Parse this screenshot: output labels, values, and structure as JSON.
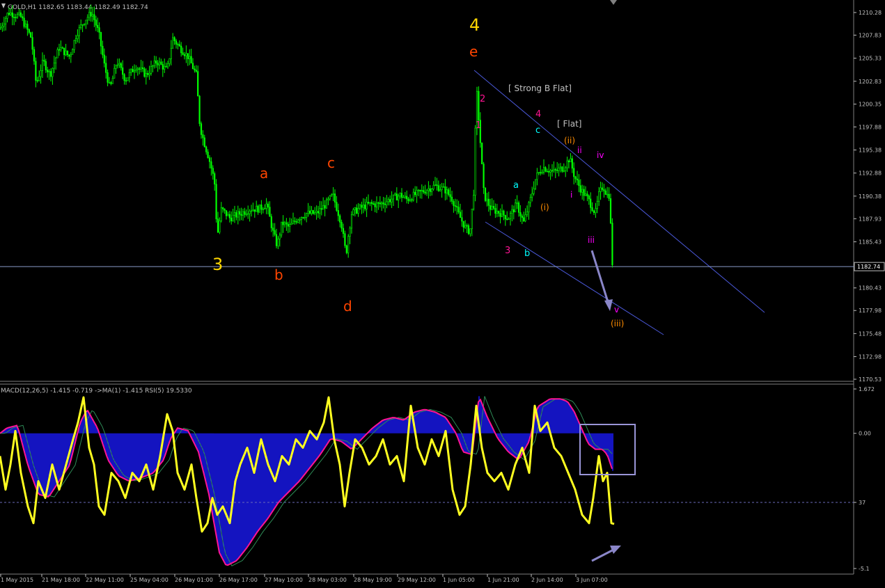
{
  "header": {
    "symbol_info": "GOLD,H1  1182.65 1183.44 1182.49 1182.74",
    "indicator_info": "MACD(12,26,5) -1.415 -0.719  ->MA(1) -1.415  RSI(5) 19.5330"
  },
  "colors": {
    "background": "#000000",
    "candles": "#00ff00",
    "axis": "#c0c0c0",
    "price_line": "#8a9cc8",
    "channel": "#4a58d8",
    "macd_hist": "#1a1af0",
    "signal_line": "#ff1493",
    "rsi_line": "#ffff20",
    "box": "#9a96d8",
    "arrow": "#8a86c8"
  },
  "chart_data": [
    {
      "type": "candlestick",
      "title": "GOLD,H1",
      "symbol": "GOLD",
      "timeframe": "H1",
      "last_bar": {
        "open": 1182.65,
        "high": 1183.44,
        "low": 1182.49,
        "close": 1182.74
      },
      "current_price_label": "1182.74",
      "y_ticks": [
        "1210.28",
        "1207.83",
        "1205.33",
        "1202.83",
        "1200.35",
        "1197.88",
        "1195.38",
        "1192.88",
        "1190.38",
        "1187.93",
        "1185.43",
        "1182.93",
        "1180.43",
        "1177.98",
        "1175.48",
        "1172.98",
        "1170.53"
      ],
      "ylim": [
        1170.53,
        1210.28
      ],
      "x_ticks": [
        "1 May 2015",
        "21 May 18:00",
        "22 May 11:00",
        "25 May 04:00",
        "26 May 01:00",
        "26 May 17:00",
        "27 May 10:00",
        "28 May 03:00",
        "28 May 19:00",
        "29 May 12:00",
        "1 Jun 05:00",
        "1 Jun 21:00",
        "2 Jun 14:00",
        "3 Jun 07:00"
      ],
      "price_path": [
        [
          0,
          1208.5
        ],
        [
          12,
          1210.3
        ],
        [
          30,
          1209.8
        ],
        [
          45,
          1207.5
        ],
        [
          52,
          1202.5
        ],
        [
          62,
          1205.0
        ],
        [
          72,
          1203.5
        ],
        [
          85,
          1206.5
        ],
        [
          100,
          1205.5
        ],
        [
          110,
          1208.0
        ],
        [
          122,
          1209.5
        ],
        [
          132,
          1210.3
        ],
        [
          142,
          1208.0
        ],
        [
          150,
          1204.5
        ],
        [
          158,
          1202.0
        ],
        [
          168,
          1205.0
        ],
        [
          180,
          1203.0
        ],
        [
          195,
          1204.5
        ],
        [
          210,
          1203.5
        ],
        [
          225,
          1205.0
        ],
        [
          240,
          1204.0
        ],
        [
          248,
          1207.5
        ],
        [
          258,
          1206.5
        ],
        [
          270,
          1205.5
        ],
        [
          282,
          1203.5
        ],
        [
          287,
          1198.0
        ],
        [
          292,
          1196.5
        ],
        [
          300,
          1194.5
        ],
        [
          308,
          1192.0
        ],
        [
          312,
          1186.0
        ],
        [
          318,
          1189.0
        ],
        [
          330,
          1188.0
        ],
        [
          345,
          1188.5
        ],
        [
          360,
          1189.0
        ],
        [
          372,
          1189.0
        ],
        [
          383,
          1189.5
        ],
        [
          392,
          1186.5
        ],
        [
          398,
          1185.0
        ],
        [
          405,
          1187.5
        ],
        [
          415,
          1187.0
        ],
        [
          428,
          1188.0
        ],
        [
          440,
          1188.5
        ],
        [
          455,
          1188.5
        ],
        [
          468,
          1189.5
        ],
        [
          478,
          1190.5
        ],
        [
          490,
          1187.5
        ],
        [
          497,
          1184.0
        ],
        [
          500,
          1186.0
        ],
        [
          505,
          1188.5
        ],
        [
          515,
          1189.0
        ],
        [
          530,
          1189.5
        ],
        [
          545,
          1189.5
        ],
        [
          560,
          1190.0
        ],
        [
          575,
          1190.5
        ],
        [
          585,
          1190.0
        ],
        [
          595,
          1190.5
        ],
        [
          610,
          1191.0
        ],
        [
          625,
          1191.5
        ],
        [
          640,
          1191.0
        ],
        [
          650,
          1190.0
        ],
        [
          658,
          1188.5
        ],
        [
          668,
          1187.0
        ],
        [
          675,
          1186.5
        ],
        [
          681,
          1191.5
        ],
        [
          684,
          1202.5
        ],
        [
          690,
          1196.0
        ],
        [
          695,
          1190.5
        ],
        [
          705,
          1189.0
        ],
        [
          720,
          1188.5
        ],
        [
          730,
          1188.0
        ],
        [
          742,
          1189.5
        ],
        [
          752,
          1187.5
        ],
        [
          760,
          1189.5
        ],
        [
          770,
          1192.5
        ],
        [
          780,
          1193.5
        ],
        [
          795,
          1193.0
        ],
        [
          810,
          1193.5
        ],
        [
          818,
          1194.5
        ],
        [
          825,
          1192.5
        ],
        [
          835,
          1191.0
        ],
        [
          845,
          1190.0
        ],
        [
          855,
          1188.5
        ],
        [
          860,
          1190.5
        ],
        [
          866,
          1191.5
        ],
        [
          872,
          1190.5
        ],
        [
          876,
          1190.5
        ],
        [
          878,
          1184.0
        ],
        [
          880,
          1182.74
        ]
      ],
      "annotations": [
        {
          "text": "4",
          "price": 1208.0,
          "color": "#ffd700"
        },
        {
          "text": "e",
          "price": 1205.5,
          "color": "#ff4500"
        },
        {
          "text": "3",
          "price": 1183.5,
          "color": "#ffd700"
        },
        {
          "text": "a",
          "price": 1192.5,
          "color": "#ff4500"
        },
        {
          "text": "b",
          "price": 1181.8,
          "color": "#ff4500"
        },
        {
          "text": "c",
          "price": 1193.5,
          "color": "#ff4500"
        },
        {
          "text": "d",
          "price": 1178.5,
          "color": "#ff4500"
        },
        {
          "text": "[ Strong B Flat]",
          "color": "#c0c0c0"
        },
        {
          "text": "[ Flat]",
          "color": "#c0c0c0"
        },
        {
          "text": "2",
          "color": "#ff1493"
        },
        {
          "text": "1",
          "color": "#ff1493"
        },
        {
          "text": "3",
          "color": "#ff1493"
        },
        {
          "text": "4",
          "color": "#ff1493"
        },
        {
          "text": "a",
          "color": "#00ffff"
        },
        {
          "text": "b",
          "color": "#00ffff"
        },
        {
          "text": "c",
          "color": "#00ffff"
        },
        {
          "text": "(i)",
          "color": "#ff8c00"
        },
        {
          "text": "(ii)",
          "color": "#ff8c00"
        },
        {
          "text": "(iii)",
          "color": "#ff8c00"
        },
        {
          "text": "i",
          "color": "#ff00ff"
        },
        {
          "text": "ii",
          "color": "#ff00ff"
        },
        {
          "text": "iii",
          "color": "#ff00ff"
        },
        {
          "text": "iv",
          "color": "#ff00ff"
        },
        {
          "text": "v",
          "color": "#ff00ff"
        }
      ]
    },
    {
      "type": "line",
      "title": "MACD(12,26,5) / RSI(5)",
      "y_ticks": [
        "1.672",
        "0.00",
        "37",
        "-5.1"
      ],
      "macd_hist_path": [
        [
          0,
          0.0
        ],
        [
          10,
          0.2
        ],
        [
          25,
          0.3
        ],
        [
          40,
          -1.2
        ],
        [
          55,
          -2.3
        ],
        [
          70,
          -2.4
        ],
        [
          85,
          -1.8
        ],
        [
          100,
          -1.2
        ],
        [
          115,
          0.4
        ],
        [
          125,
          0.9
        ],
        [
          140,
          0.2
        ],
        [
          155,
          -1.0
        ],
        [
          170,
          -1.6
        ],
        [
          185,
          -1.8
        ],
        [
          200,
          -1.7
        ],
        [
          220,
          -1.5
        ],
        [
          235,
          -1.0
        ],
        [
          245,
          -0.2
        ],
        [
          255,
          0.2
        ],
        [
          270,
          0.1
        ],
        [
          285,
          -0.7
        ],
        [
          300,
          -2.3
        ],
        [
          315,
          -4.5
        ],
        [
          325,
          -5.0
        ],
        [
          340,
          -4.8
        ],
        [
          355,
          -4.3
        ],
        [
          370,
          -3.7
        ],
        [
          385,
          -3.2
        ],
        [
          400,
          -2.6
        ],
        [
          415,
          -2.2
        ],
        [
          430,
          -1.8
        ],
        [
          445,
          -1.3
        ],
        [
          460,
          -0.8
        ],
        [
          475,
          -0.2
        ],
        [
          490,
          -0.3
        ],
        [
          505,
          -0.6
        ],
        [
          520,
          -0.2
        ],
        [
          535,
          0.2
        ],
        [
          550,
          0.5
        ],
        [
          565,
          0.6
        ],
        [
          580,
          0.5
        ],
        [
          595,
          0.8
        ],
        [
          610,
          0.9
        ],
        [
          625,
          0.8
        ],
        [
          640,
          0.6
        ],
        [
          655,
          0.0
        ],
        [
          665,
          -0.7
        ],
        [
          678,
          -0.8
        ],
        [
          688,
          1.4
        ],
        [
          700,
          0.6
        ],
        [
          715,
          -0.2
        ],
        [
          730,
          -0.7
        ],
        [
          745,
          -1.0
        ],
        [
          760,
          -0.3
        ],
        [
          772,
          1.0
        ],
        [
          790,
          1.3
        ],
        [
          805,
          1.3
        ],
        [
          815,
          1.2
        ],
        [
          825,
          0.8
        ],
        [
          835,
          0.2
        ],
        [
          845,
          -0.4
        ],
        [
          855,
          -0.6
        ],
        [
          865,
          -0.6
        ],
        [
          872,
          -0.8
        ],
        [
          880,
          -1.415
        ]
      ],
      "rsi_path": [
        [
          0,
          60
        ],
        [
          8,
          40
        ],
        [
          15,
          55
        ],
        [
          22,
          75
        ],
        [
          30,
          50
        ],
        [
          40,
          30
        ],
        [
          48,
          20
        ],
        [
          55,
          45
        ],
        [
          65,
          35
        ],
        [
          75,
          55
        ],
        [
          85,
          40
        ],
        [
          95,
          55
        ],
        [
          105,
          70
        ],
        [
          112,
          80
        ],
        [
          120,
          95
        ],
        [
          128,
          65
        ],
        [
          135,
          55
        ],
        [
          142,
          30
        ],
        [
          150,
          25
        ],
        [
          160,
          50
        ],
        [
          170,
          45
        ],
        [
          180,
          35
        ],
        [
          190,
          50
        ],
        [
          200,
          45
        ],
        [
          210,
          55
        ],
        [
          220,
          40
        ],
        [
          230,
          60
        ],
        [
          240,
          85
        ],
        [
          248,
          75
        ],
        [
          255,
          50
        ],
        [
          265,
          40
        ],
        [
          275,
          55
        ],
        [
          282,
          35
        ],
        [
          290,
          15
        ],
        [
          298,
          20
        ],
        [
          305,
          35
        ],
        [
          312,
          25
        ],
        [
          320,
          30
        ],
        [
          330,
          20
        ],
        [
          338,
          45
        ],
        [
          345,
          55
        ],
        [
          355,
          65
        ],
        [
          365,
          50
        ],
        [
          375,
          70
        ],
        [
          385,
          55
        ],
        [
          395,
          45
        ],
        [
          405,
          60
        ],
        [
          415,
          55
        ],
        [
          425,
          70
        ],
        [
          435,
          65
        ],
        [
          445,
          75
        ],
        [
          455,
          70
        ],
        [
          465,
          80
        ],
        [
          472,
          95
        ],
        [
          480,
          70
        ],
        [
          488,
          55
        ],
        [
          495,
          30
        ],
        [
          502,
          50
        ],
        [
          510,
          70
        ],
        [
          520,
          65
        ],
        [
          530,
          55
        ],
        [
          540,
          60
        ],
        [
          550,
          70
        ],
        [
          560,
          55
        ],
        [
          570,
          60
        ],
        [
          580,
          45
        ],
        [
          590,
          90
        ],
        [
          600,
          65
        ],
        [
          610,
          55
        ],
        [
          620,
          70
        ],
        [
          630,
          60
        ],
        [
          640,
          75
        ],
        [
          650,
          40
        ],
        [
          660,
          25
        ],
        [
          668,
          30
        ],
        [
          676,
          55
        ],
        [
          684,
          90
        ],
        [
          692,
          65
        ],
        [
          700,
          50
        ],
        [
          710,
          45
        ],
        [
          720,
          50
        ],
        [
          730,
          40
        ],
        [
          740,
          55
        ],
        [
          750,
          65
        ],
        [
          760,
          50
        ],
        [
          768,
          90
        ],
        [
          776,
          75
        ],
        [
          786,
          80
        ],
        [
          796,
          65
        ],
        [
          806,
          60
        ],
        [
          816,
          50
        ],
        [
          826,
          40
        ],
        [
          836,
          25
        ],
        [
          846,
          20
        ],
        [
          852,
          35
        ],
        [
          860,
          60
        ],
        [
          866,
          45
        ],
        [
          872,
          50
        ],
        [
          878,
          20
        ],
        [
          882,
          19.533
        ]
      ]
    }
  ]
}
